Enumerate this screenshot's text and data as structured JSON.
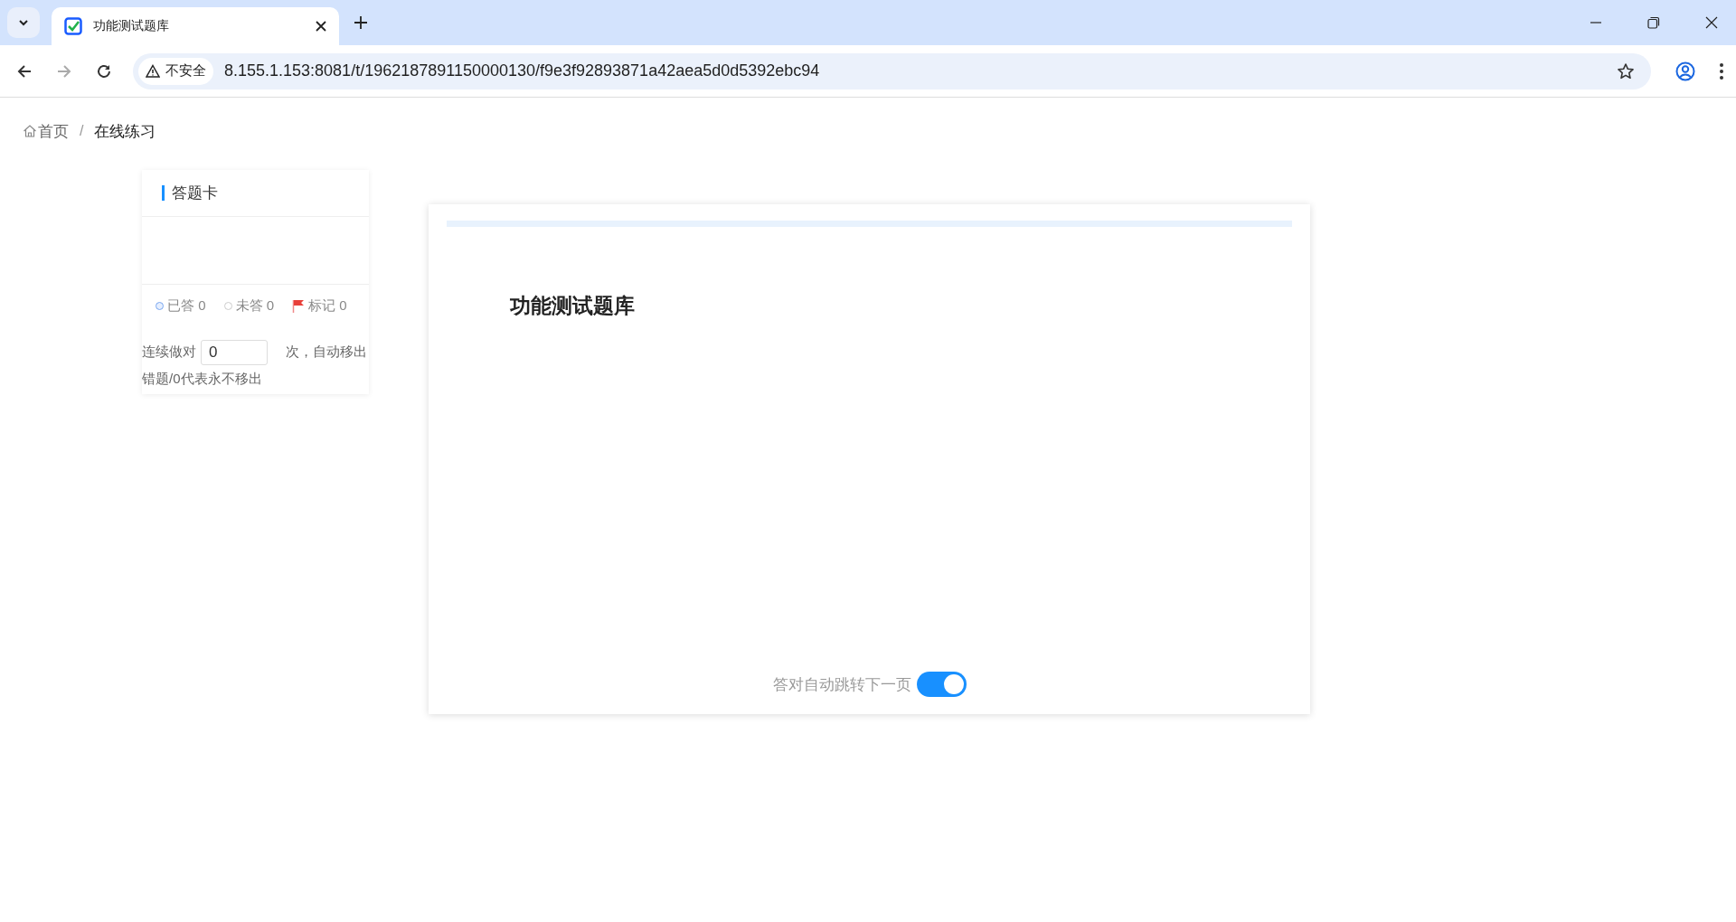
{
  "browser": {
    "tab": {
      "title": "功能测试题库"
    },
    "address_bar": {
      "security": "不安全",
      "url": "8.155.1.153:8081/t/1962187891150000130/f9e3f92893871a42aea5d0d5392ebc94"
    }
  },
  "breadcrumb": {
    "separator": "/",
    "items": [
      {
        "label": "首页"
      },
      {
        "label": "在线练习"
      }
    ]
  },
  "answer_card": {
    "title": "答题卡",
    "legend": [
      {
        "kind": "answered",
        "label": "已答 0"
      },
      {
        "kind": "unanswered",
        "label": "未答 0"
      },
      {
        "kind": "flagged",
        "label": "标记 0"
      }
    ],
    "auto_remove": {
      "prefix": "连续做对",
      "value": "0",
      "suffix": "次，自动移出",
      "note": "错题/0代表永不移出"
    }
  },
  "quiz": {
    "title": "功能测试题库",
    "auto_next": {
      "label": "答对自动跳转下一页",
      "on": true
    }
  }
}
